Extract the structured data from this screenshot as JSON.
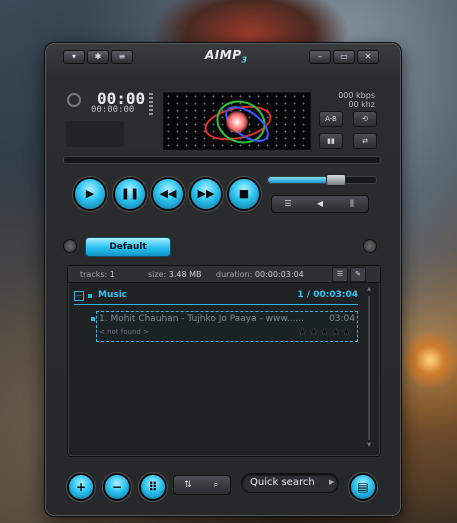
{
  "window": {
    "title": "AIMP",
    "title_version": "3",
    "buttons": [
      "menu",
      "settings",
      "equalizer"
    ],
    "controls": [
      "minimize",
      "maximize",
      "close"
    ]
  },
  "display": {
    "time_main": "00:00",
    "time_sub": "00:00:00",
    "bitrate": "000 kbps",
    "samplerate": "00 khz",
    "ab_label": "A-B"
  },
  "transport": {
    "play": "▶",
    "pause": "❚❚",
    "prev": "◀◀",
    "next": "▶▶",
    "stop": "■"
  },
  "volume": {
    "level": 0.62
  },
  "playlist_tab": {
    "label": "Default"
  },
  "playlist_info": {
    "tracks_label": "tracks:",
    "tracks_value": "1",
    "size_label": "size:",
    "size_value": "3.48 MB",
    "duration_label": "duration:",
    "duration_value": "00:00:03:04"
  },
  "group": {
    "toggle": "−",
    "name": "Music",
    "stats": "1 / 00:03:04"
  },
  "tracks": [
    {
      "title": "1. Mohit Chauhan - Tujhko Jo Paaya - www......",
      "time": "03:04",
      "sub": "< not found >",
      "rating_stars": "★★★★★"
    }
  ],
  "bottom": {
    "add": "+",
    "remove": "−",
    "menu": "⠿",
    "search_placeholder": "Quick search"
  }
}
